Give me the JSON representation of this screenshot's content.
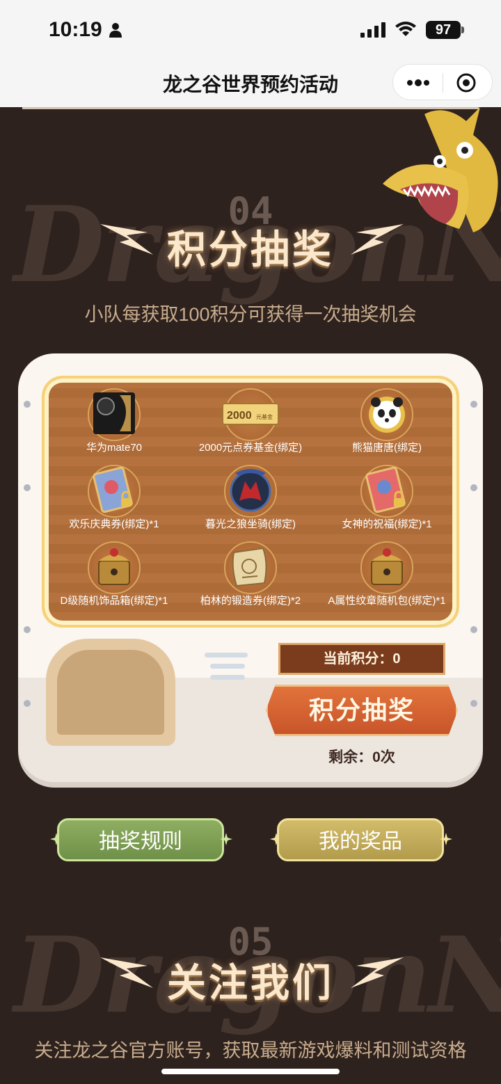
{
  "status_bar": {
    "time": "10:19",
    "battery": "97"
  },
  "nav": {
    "title": "龙之谷世界预约活动"
  },
  "background_word": "DragonNest",
  "lottery": {
    "section_number": "04",
    "title": "积分抽奖",
    "subtitle": "小队每获取100积分可获得一次抽奖机会",
    "prizes": [
      {
        "label": "华为mate70",
        "icon": "phone-icon"
      },
      {
        "label": "2000元点券基金(绑定)",
        "icon": "voucher-icon",
        "voucher_text": "2000",
        "voucher_unit": "元基金"
      },
      {
        "label": "熊猫唐唐(绑定)",
        "icon": "panda-icon"
      },
      {
        "label": "欢乐庆典券(绑定)*1",
        "icon": "ticket-icon"
      },
      {
        "label": "暮光之狼坐骑(绑定)",
        "icon": "wolf-mount-icon"
      },
      {
        "label": "女神的祝福(绑定)*1",
        "icon": "blessing-card-icon"
      },
      {
        "label": "D级随机饰品箱(绑定)*1",
        "icon": "accessory-box-icon"
      },
      {
        "label": "柏林的锻造券(绑定)*2",
        "icon": "scroll-icon"
      },
      {
        "label": "A属性纹章随机包(绑定)*1",
        "icon": "emblem-pack-icon"
      }
    ],
    "points_label": "当前积分：0",
    "draw_button": "积分抽奖",
    "remaining": "剩余：0次"
  },
  "buttons": {
    "rules": "抽奖规则",
    "my_prizes": "我的奖品"
  },
  "follow": {
    "section_number": "05",
    "title": "关注我们",
    "subtitle": "关注龙之谷官方账号，获取最新游戏爆料和测试资格"
  },
  "colors": {
    "page_bg": "#2e221e",
    "title_glow": "#fbe8cc",
    "panel_brown": "#b5723e",
    "green_button": "#8fae62",
    "gold_button": "#d2bc6a"
  }
}
